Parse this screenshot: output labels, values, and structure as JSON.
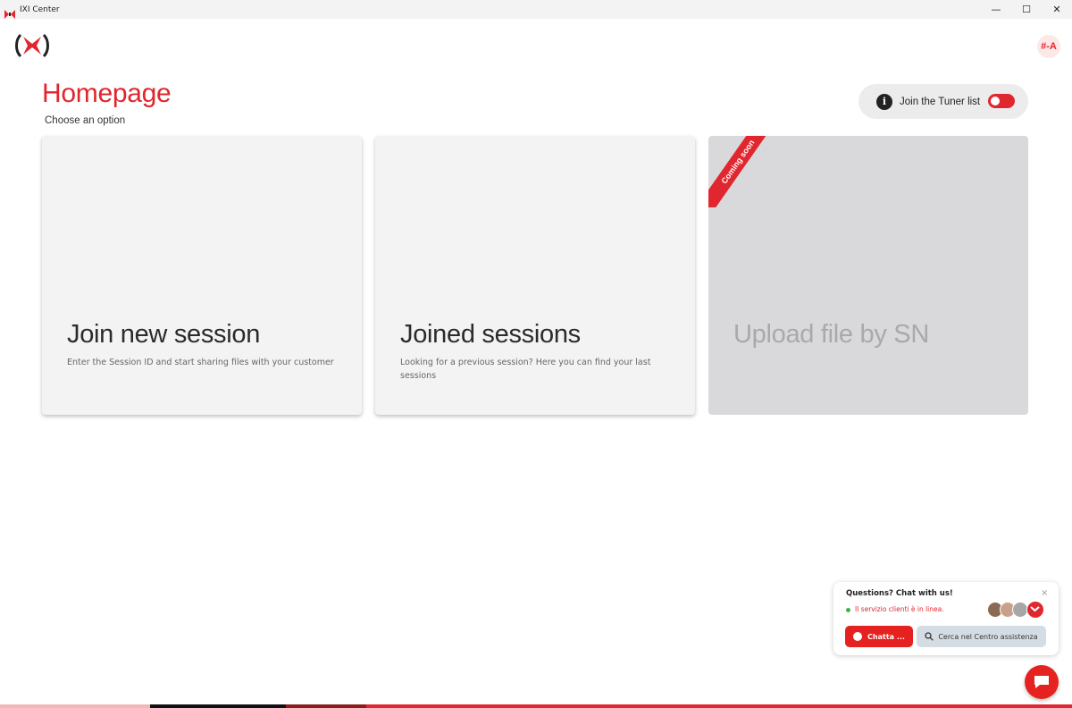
{
  "window": {
    "title": "IXI Center",
    "minimize_glyph": "—",
    "maximize_glyph": "☐",
    "close_glyph": "✕"
  },
  "header": {
    "logo_icon": "ixi-logo-icon",
    "user_initials": "#-A"
  },
  "page": {
    "title": "Homepage",
    "subtitle": "Choose an option"
  },
  "tuner": {
    "info_glyph": "i",
    "label": "Join the Tuner list",
    "toggle_on": true
  },
  "cards": [
    {
      "title": "Join new session",
      "description": "Enter the Session ID and start sharing files with your customer",
      "enabled": true
    },
    {
      "title": "Joined sessions",
      "description": "Looking for a previous session? Here you can find your last sessions",
      "enabled": true
    },
    {
      "title": "Upload file by SN",
      "description": "",
      "enabled": false,
      "ribbon": "Coming soon"
    }
  ],
  "chat": {
    "title": "Questions? Chat with us!",
    "close_glyph": "×",
    "status": "Il servizio clienti è in linea.",
    "chat_button": "Chatta ...",
    "help_button": "Cerca nel Centro assistenza"
  },
  "colors": {
    "brand_red": "#e0262e",
    "card_bg": "#f3f3f3",
    "card_disabled_bg": "#d9d9db",
    "online_green": "#3bb54a"
  }
}
